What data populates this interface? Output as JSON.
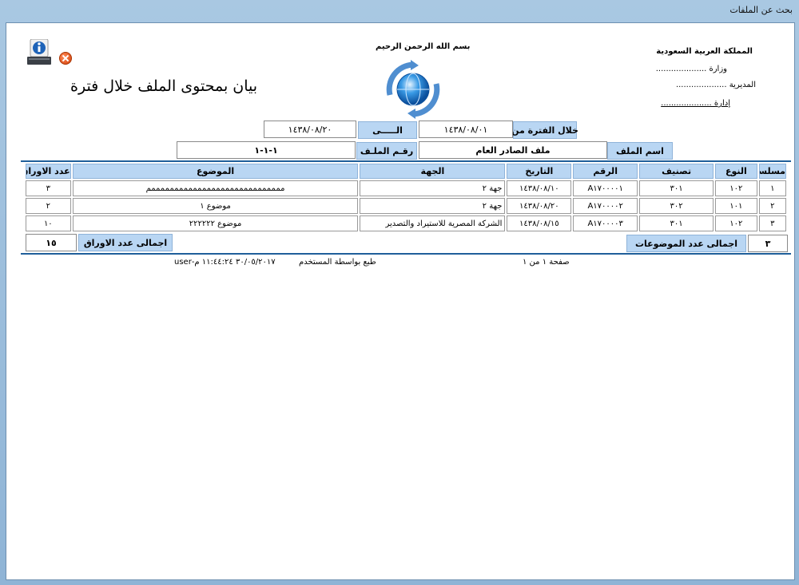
{
  "window": {
    "title": "بحث عن الملفات"
  },
  "header": {
    "country": "المملكة العربية السعودية",
    "ministry": "وزارة ....................",
    "directorate": "المديرية ....................",
    "department": "إدارة ....................",
    "basmala": "بسم الله الرحمن الرحيم",
    "report_title": "بيان بمحتوى الملف خلال فترة"
  },
  "filters": {
    "period_from_label": "خلال الفترة من",
    "period_from_value": "١٤٣٨/٠٨/٠١",
    "to_label": "الـــــى",
    "to_value": "١٤٣٨/٠٨/٢٠",
    "file_name_label": "اسم الملف",
    "file_name_value": "ملف الصادر العام",
    "file_number_label": "رقـم الملـف",
    "file_number_value": "١-١-١"
  },
  "table": {
    "headers": [
      "مسلسل",
      "النوع",
      "تصنيف",
      "الرقم",
      "التاريخ",
      "الجهة",
      "الموضوع",
      "عدد الاوراق"
    ],
    "rows": [
      [
        "١",
        "١٠٢",
        "٣٠١",
        "A١٧٠٠٠٠١",
        "١٤٣٨/٠٨/١٠",
        "جهة ٢",
        "مممممممممممممممممممممممممممممم",
        "٣"
      ],
      [
        "٢",
        "١٠١",
        "٣٠٢",
        "A١٧٠٠٠٠٢",
        "١٤٣٨/٠٨/٢٠",
        "جهة ٢",
        "موضوع ١",
        "٢"
      ],
      [
        "٣",
        "١٠٢",
        "٣٠١",
        "A١٧٠٠٠٠٣",
        "١٤٣٨/٠٨/١٥",
        "الشركة المصرية للاستيراد والتصدير",
        "موضوع ٢٢٢٢٢٢",
        "١٠"
      ]
    ]
  },
  "totals": {
    "subjects_label": "اجمالى عدد الموضوعات",
    "subjects_value": "٣",
    "pages_label": "اجمالى عدد الاوراق",
    "pages_value": "١٥"
  },
  "footer": {
    "page_info": "صفحة ١ من ١",
    "printed_by_label": "طبع بواسطة المستخدم",
    "printed_by_value": "٣٠/٠٥/٢٠١٧ ١١:٤٤:٢٤ م-user"
  },
  "icons": {
    "info": "info-computer-icon",
    "close": "close-icon",
    "logo": "globe-refresh-logo"
  }
}
